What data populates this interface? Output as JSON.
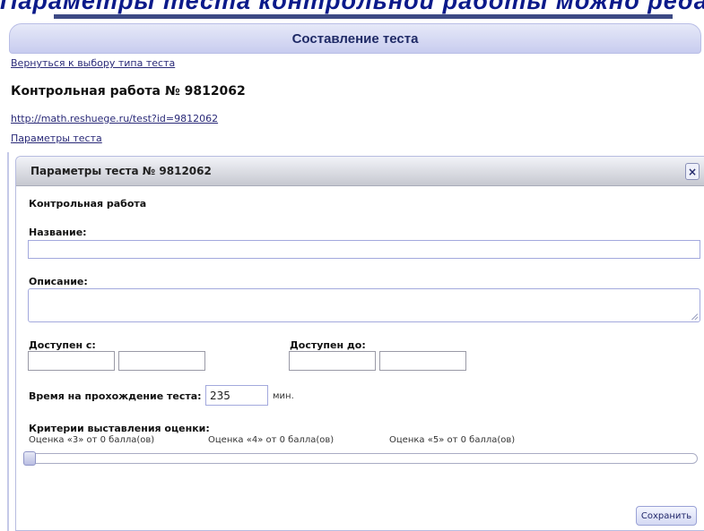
{
  "caption": {
    "text": "Параметры теста контрольной работы можно редактировать"
  },
  "header": {
    "title": "Составление теста"
  },
  "nav": {
    "back_link": "Вернуться к выбору типа теста"
  },
  "work": {
    "title": "Контрольная работа № 9812062",
    "url": "http://math.reshuege.ru/test?id=9812062",
    "params_link": "Параметры теста"
  },
  "dialog": {
    "title": "Параметры теста № 9812062",
    "close_label": "×",
    "type_label": "Контрольная работа",
    "name_label": "Название:",
    "name_value": "",
    "description_label": "Описание:",
    "description_value": "",
    "available_from_label": "Доступен с:",
    "available_to_label": "Доступен до:",
    "available_from_date": "",
    "available_from_time": "",
    "available_to_date": "",
    "available_to_time": "",
    "time_label": "Время на прохождение теста:",
    "time_value": "235",
    "time_unit": "мин.",
    "criteria_label": "Критерии выставления оценки:",
    "grades": [
      {
        "label": "Оценка «3» от 0 балла(ов)"
      },
      {
        "label": "Оценка «4» от 0 балла(ов)"
      },
      {
        "label": "Оценка «5» от 0 балла(ов)"
      }
    ],
    "slider_value": 0,
    "save_label": "Сохранить"
  },
  "colors": {
    "accent": "#c8ccef",
    "link": "#2a2a78",
    "field_border": "#a3a9dd"
  }
}
